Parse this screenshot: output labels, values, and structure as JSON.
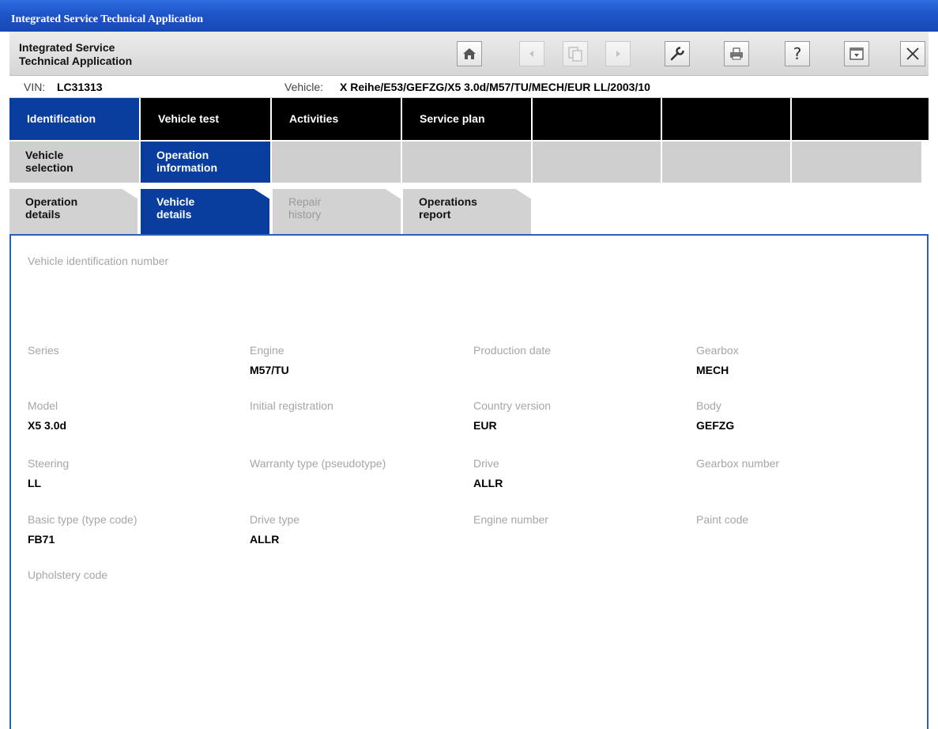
{
  "window": {
    "title": "Integrated Service Technical Application"
  },
  "toolbar": {
    "app_name_line1": "Integrated Service",
    "app_name_line2": "Technical Application",
    "buttons": [
      "home-icon",
      "back-icon",
      "copy-icon",
      "forward-icon",
      "wrench-icon",
      "printer-icon",
      "help-icon",
      "dropdown-window-icon",
      "close-icon"
    ]
  },
  "vehicle_bar": {
    "vin_label": "VIN:",
    "vin": "LC31313",
    "vehicle_label": "Vehicle:",
    "vehicle": "X Reihe/E53/GEFZG/X5 3.0d/M57/TU/MECH/EUR LL/2003/10"
  },
  "main_nav": [
    "Identification",
    "Vehicle test",
    "Activities",
    "Service plan"
  ],
  "sub_nav": {
    "vehicle_selection_l1": "Vehicle",
    "vehicle_selection_l2": "selection",
    "operation_information_l1": "Operation",
    "operation_information_l2": "information"
  },
  "tabs": {
    "operation_details_l1": "Operation",
    "operation_details_l2": "details",
    "vehicle_details_l1": "Vehicle",
    "vehicle_details_l2": "details",
    "repair_history_l1": "Repair",
    "repair_history_l2": "history",
    "operations_report_l1": "Operations",
    "operations_report_l2": "report"
  },
  "details": {
    "vin_label": "Vehicle identification number",
    "fields": [
      {
        "label": "Series",
        "value": ""
      },
      {
        "label": "Engine",
        "value": "M57/TU"
      },
      {
        "label": "Production date",
        "value": ""
      },
      {
        "label": "Gearbox",
        "value": "MECH"
      },
      {
        "label": "Model",
        "value": "X5 3.0d"
      },
      {
        "label": "Initial registration",
        "value": ""
      },
      {
        "label": "Country version",
        "value": "EUR"
      },
      {
        "label": "Body",
        "value": "GEFZG"
      },
      {
        "label": "Steering",
        "value": "LL"
      },
      {
        "label": "Warranty type (pseudotype)",
        "value": ""
      },
      {
        "label": "Drive",
        "value": "ALLR"
      },
      {
        "label": "Gearbox number",
        "value": ""
      },
      {
        "label": "Basic type (type code)",
        "value": "FB71"
      },
      {
        "label": "Drive type",
        "value": "ALLR"
      },
      {
        "label": "Engine number",
        "value": ""
      },
      {
        "label": "Paint code",
        "value": ""
      },
      {
        "label": "Upholstery code",
        "value": ""
      }
    ]
  },
  "colors": {
    "active_blue": "#0a3e9e",
    "title_blue": "#1d55c8",
    "label_gray": "#a6a6a6"
  }
}
